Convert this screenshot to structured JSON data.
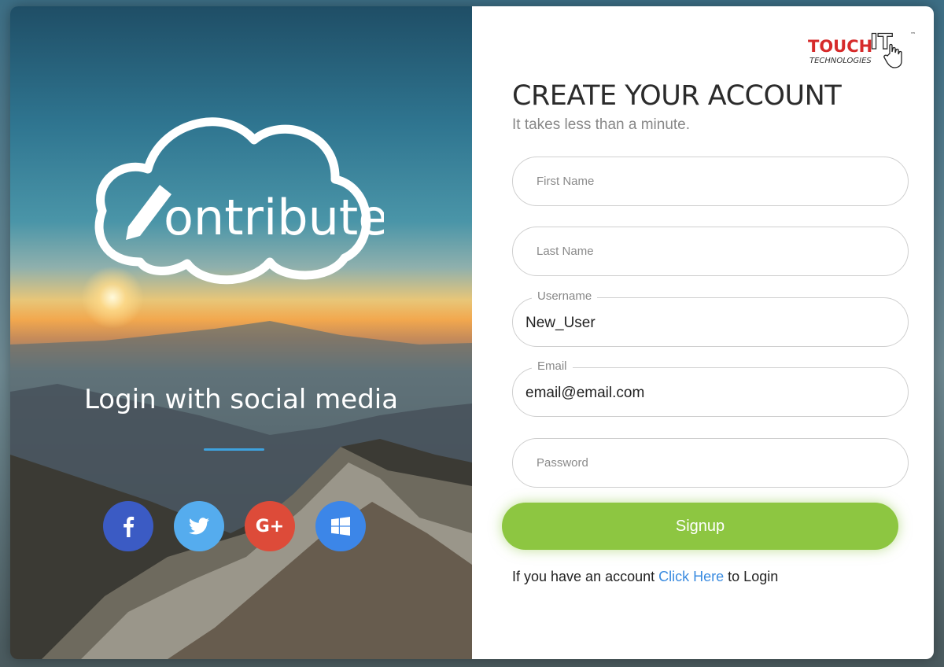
{
  "left": {
    "logo_text": "ontribute",
    "social_title": "Login with social media",
    "socials": [
      {
        "name": "facebook",
        "glyph": "f",
        "color": "#3b5bc4"
      },
      {
        "name": "twitter",
        "glyph": "twitter-bird",
        "color": "#55acee"
      },
      {
        "name": "google-plus",
        "glyph": "G+",
        "color": "#dd4b39"
      },
      {
        "name": "windows",
        "glyph": "windows-logo",
        "color": "#3c86e8"
      }
    ]
  },
  "right": {
    "brand": {
      "touch": "TOUCH",
      "it": "IT",
      "tm": "™",
      "sub": "TECHNOLOGIES"
    },
    "title": "CREATE YOUR ACCOUNT",
    "subtitle": "It takes less than a minute.",
    "fields": {
      "first_name": {
        "placeholder": "First Name",
        "value": ""
      },
      "last_name": {
        "placeholder": "Last Name",
        "value": ""
      },
      "username": {
        "label": "Username",
        "value": "New_User"
      },
      "email": {
        "label": "Email",
        "value": "email@email.com"
      },
      "password": {
        "placeholder": "Password",
        "value": ""
      }
    },
    "signup_label": "Signup",
    "login_prefix": "If you have an account",
    "login_link": "Click Here",
    "login_suffix": "to Login"
  },
  "colors": {
    "accent_green": "#8dc641",
    "link_blue": "#3a8be0",
    "divider_blue": "#3ea2de"
  }
}
